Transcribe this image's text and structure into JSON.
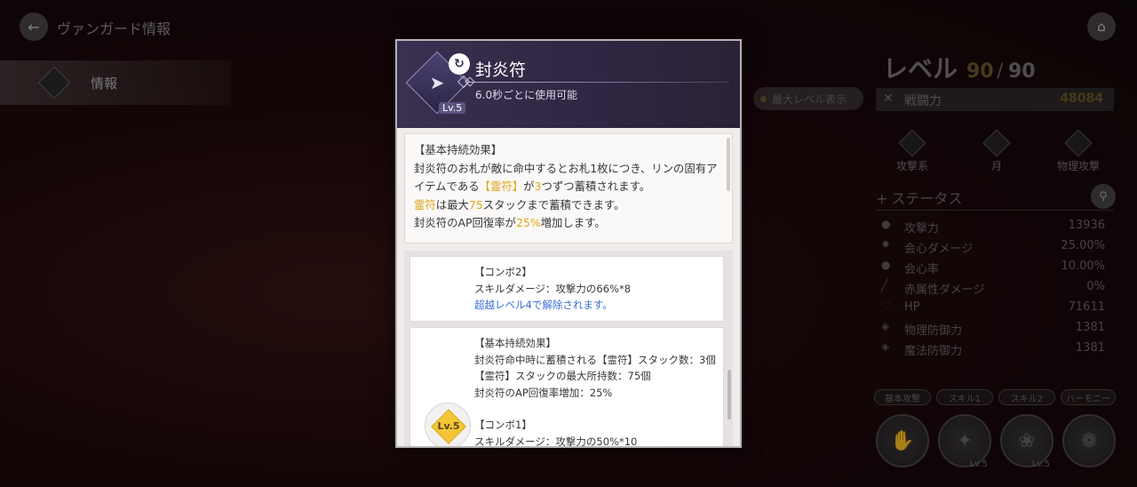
{
  "header": {
    "title": "ヴァンガード情報"
  },
  "left_menu": {
    "items": [
      {
        "label": "情報"
      }
    ]
  },
  "right_panel": {
    "level_label": "レベル",
    "level_value": "90",
    "level_sep": "/",
    "level_max": "90",
    "max_level_toggle": "最大レベル表示",
    "power_label": "戦闘力",
    "power_value": "48084",
    "attributes": [
      "攻撃系",
      "月",
      "物理攻撃"
    ],
    "status_header": "ステータス",
    "stats": [
      {
        "label": "攻撃力",
        "value": "13936"
      },
      {
        "label": "会心ダメージ",
        "value": "25.00%"
      },
      {
        "label": "会心率",
        "value": "10.00%"
      },
      {
        "label": "赤属性ダメージ",
        "value": "0%"
      },
      {
        "label": "HP",
        "value": "71611"
      },
      {
        "label": "物理防御力",
        "value": "1381"
      },
      {
        "label": "魔法防御力",
        "value": "1381"
      }
    ],
    "skill_tabs": [
      "基本攻撃",
      "スキル1",
      "スキル2",
      "ハーモニー"
    ],
    "skill_levels": [
      "Lv.5",
      "Lv.5"
    ]
  },
  "modal": {
    "skill_name": "封炎符",
    "skill_level": "Lv.5",
    "cooldown": "6.0秒ごとに使用可能",
    "desc": {
      "heading": "【基本持続効果】",
      "line1": "封炎符のお札が敵に命中するとお札1枚につき、リンの固有ア",
      "line2a": "イテムである",
      "line2b": "【霊符】",
      "line2c": "が",
      "line2d": "3",
      "line2e": "つずつ蓄積されます。",
      "line3a": "霊符",
      "line3b": "は最大",
      "line3c": "75",
      "line3d": "スタックまで蓄積できます。",
      "line4a": "封炎符のAP回復率が",
      "line4b": "25%",
      "line4c": "増加します。"
    },
    "card1": {
      "title": "【コンボ2】",
      "line1": "スキルダメージ：攻撃力の66%*8",
      "unlock": "超越レベル4で解除されます。"
    },
    "card2": {
      "title": "【基本持続効果】",
      "line1": "封炎符命中時に蓄積される【霊符】スタック数：3個",
      "line2": "【霊符】スタックの最大所持数：75個",
      "line3": "封炎符のAP回復率増加：25%",
      "combo_title": "【コンボ1】",
      "combo_line": "スキルダメージ：攻撃力の50%*10",
      "badge": "Lv.5"
    }
  }
}
